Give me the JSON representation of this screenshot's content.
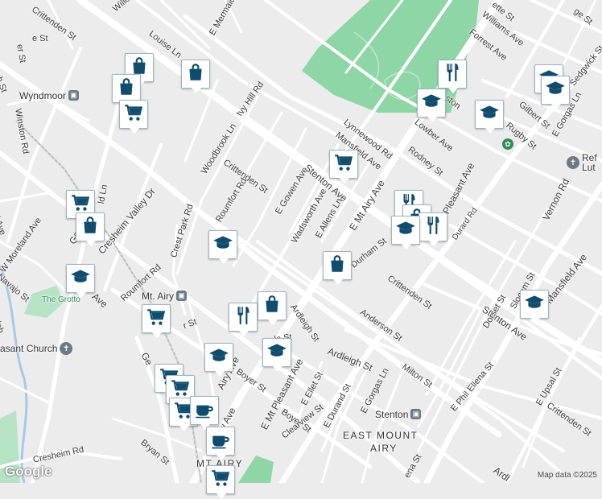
{
  "map": {
    "footer": "Map data ©2025",
    "logo": "Google",
    "places": [
      {
        "id": "wyndmoor",
        "text": "Wyndmoor"
      },
      {
        "id": "mt-airy",
        "text": "Mt. Airy"
      },
      {
        "id": "stenton",
        "text": "Stenton"
      },
      {
        "id": "east-mount-airy",
        "text": "EAST MOUNT"
      },
      {
        "id": "east-mount-airy-2",
        "text": "AIRY"
      },
      {
        "id": "mt-airy-bottom",
        "text": "MT AIRY"
      },
      {
        "id": "grotto",
        "text": "The Grotto"
      },
      {
        "id": "pleasant-church",
        "text": "asant Church"
      },
      {
        "id": "ref-lut-1",
        "text": "Ref"
      },
      {
        "id": "ref-lut-2",
        "text": "Lut"
      }
    ],
    "streets": [
      {
        "id": "crittenden-top",
        "text": "Crittenden St"
      },
      {
        "id": "willow",
        "text": "Willo"
      },
      {
        "id": "louise",
        "text": "Louise Ln"
      },
      {
        "id": "mermaid",
        "text": "E Mermaid"
      },
      {
        "id": "ivy-hill",
        "text": "Ivy Hill Rd"
      },
      {
        "id": "woodbrook",
        "text": "Woodbrook Ln"
      },
      {
        "id": "crittenden-mid",
        "text": "Crittenden St"
      },
      {
        "id": "roumfort-top",
        "text": "Roumfort Rd"
      },
      {
        "id": "e-gowen",
        "text": "E Gowen Ave"
      },
      {
        "id": "stenton-ave",
        "text": "Stenton Ave"
      },
      {
        "id": "wadsworth",
        "text": "Wadsworth Ave"
      },
      {
        "id": "e-allens",
        "text": "E Allens Ln"
      },
      {
        "id": "mansfield",
        "text": "Mansfield Ave"
      },
      {
        "id": "lynnewood",
        "text": "Lynnewood Rd"
      },
      {
        "id": "e-mt-airy",
        "text": "E Mt Airy Ave"
      },
      {
        "id": "winston",
        "text": "Winston Rd"
      },
      {
        "id": "cresheim-valley",
        "text": "Cresheim Valley Dr"
      },
      {
        "id": "crest-park",
        "text": "Crest Park Rd"
      },
      {
        "id": "roumfort-left",
        "text": "Roumfort Rd"
      },
      {
        "id": "w-moreland",
        "text": "W Moreland Ave"
      },
      {
        "id": "navajo",
        "text": "Navajo St"
      },
      {
        "id": "germantown",
        "text": "German"
      },
      {
        "id": "germantown-2",
        "text": "Ave"
      },
      {
        "id": "durham",
        "text": "Durham St"
      },
      {
        "id": "crittenden-right",
        "text": "Crittenden St"
      },
      {
        "id": "anderson",
        "text": "Anderson St"
      },
      {
        "id": "ardleigh",
        "text": "Ardleigh St"
      },
      {
        "id": "ardleigh-2",
        "text": "Ardleigh St"
      },
      {
        "id": "milton",
        "text": "Milton St"
      },
      {
        "id": "boyer",
        "text": "Boyer St"
      },
      {
        "id": "boyer-2",
        "text": "Boyer St"
      },
      {
        "id": "e-mt-pleasant",
        "text": "E Mt Pleasant Ave"
      },
      {
        "id": "e-ellet",
        "text": "E Ellet St"
      },
      {
        "id": "e-durand",
        "text": "E Durand St"
      },
      {
        "id": "e-gorgas",
        "text": "E Gorgas Ln"
      },
      {
        "id": "clearview",
        "text": "Clearview St"
      },
      {
        "id": "e-phil-ellena",
        "text": "E Phil Ellena St"
      },
      {
        "id": "e-upsal",
        "text": "E Upsal St"
      },
      {
        "id": "crittenden-br",
        "text": "Crittenden St"
      },
      {
        "id": "stenton-ave-2",
        "text": "Stenton Ave"
      },
      {
        "id": "mansfield-2",
        "text": "Mansfield Ave"
      },
      {
        "id": "vernon",
        "text": "Vernon Rd"
      },
      {
        "id": "durard",
        "text": "Durard Rd"
      },
      {
        "id": "dorset",
        "text": "Dorset St"
      },
      {
        "id": "slocum",
        "text": "Slocum St"
      },
      {
        "id": "pleasant-ave",
        "text": "Pleasant Ave"
      },
      {
        "id": "rodney",
        "text": "Rodney St"
      },
      {
        "id": "lowber",
        "text": "Lowber Ave"
      },
      {
        "id": "gilbert",
        "text": "Gilbert St"
      },
      {
        "id": "rugby",
        "text": "Rugby St"
      },
      {
        "id": "e-gorgas-top",
        "text": "E Gorgas Ln"
      },
      {
        "id": "williams",
        "text": "Williams Ave"
      },
      {
        "id": "forrest",
        "text": "Forrest Ave"
      },
      {
        "id": "sedgwick",
        "text": "Sedgwick St"
      },
      {
        "id": "ette-st",
        "text": "ette St"
      },
      {
        "id": "ge-st",
        "text": "ge St"
      },
      {
        "id": "cresheim-rd",
        "text": "Cresheim Rd"
      },
      {
        "id": "bryan",
        "text": "Bryan St"
      },
      {
        "id": "gen",
        "text": "Ge"
      },
      {
        "id": "new-ave",
        "text": "New Ave"
      },
      {
        "id": "airy-ave",
        "text": "Airy Ave"
      },
      {
        "id": "le-st",
        "text": "le St"
      },
      {
        "id": "ston",
        "text": "ston"
      },
      {
        "id": "ldh",
        "text": "ld Ln"
      },
      {
        "id": "olnh",
        "text": "olnh"
      },
      {
        "id": "h-st",
        "text": "h St"
      },
      {
        "id": "d-ave",
        "text": "d Ave"
      },
      {
        "id": "r-st",
        "text": "r St"
      },
      {
        "id": "ardl",
        "text": "Ardl"
      },
      {
        "id": "ena-st",
        "text": "ena St"
      },
      {
        "id": "e-st",
        "text": "e St"
      },
      {
        "id": "ler-st",
        "text": "er St"
      }
    ],
    "markers": [
      {
        "id": "shop-1",
        "icon": "shopping-bag-icon"
      },
      {
        "id": "shop-2",
        "icon": "shopping-bag-icon"
      },
      {
        "id": "shop-3",
        "icon": "shopping-bag-icon"
      },
      {
        "id": "cart-1",
        "icon": "shopping-cart-icon"
      },
      {
        "id": "cart-2",
        "icon": "shopping-cart-icon"
      },
      {
        "id": "shop-4",
        "icon": "shopping-bag-icon"
      },
      {
        "id": "school-1",
        "icon": "graduation-cap-icon"
      },
      {
        "id": "cart-3",
        "icon": "shopping-cart-icon"
      },
      {
        "id": "school-2",
        "icon": "graduation-cap-icon"
      },
      {
        "id": "shop-5",
        "icon": "shopping-bag-icon"
      },
      {
        "id": "food-1",
        "icon": "fork-knife-icon"
      },
      {
        "id": "school-3",
        "icon": "graduation-cap-icon"
      },
      {
        "id": "school-4",
        "icon": "graduation-cap-icon"
      },
      {
        "id": "school-5",
        "icon": "graduation-cap-icon"
      },
      {
        "id": "school-6",
        "icon": "graduation-cap-icon"
      },
      {
        "id": "food-2",
        "icon": "fork-knife-icon"
      },
      {
        "id": "shop-6",
        "icon": "shopping-bag-icon"
      },
      {
        "id": "food-3",
        "icon": "fork-knife-icon"
      },
      {
        "id": "cart-4",
        "icon": "shopping-cart-icon"
      },
      {
        "id": "school-7",
        "icon": "graduation-cap-icon"
      },
      {
        "id": "school-8",
        "icon": "graduation-cap-icon"
      },
      {
        "id": "cart-5",
        "icon": "shopping-cart-icon"
      },
      {
        "id": "cart-6",
        "icon": "shopping-cart-icon"
      },
      {
        "id": "coffee-1",
        "icon": "coffee-cup-icon"
      },
      {
        "id": "coffee-2",
        "icon": "coffee-cup-icon"
      },
      {
        "id": "cart-7",
        "icon": "shopping-cart-icon"
      },
      {
        "id": "school-9",
        "icon": "graduation-cap-icon"
      }
    ],
    "colors": {
      "background": "#ececec",
      "road": "#ffffff",
      "park": "#8ed6a6",
      "marker": "#0f4c6e",
      "water": "#a8c8e8"
    }
  }
}
